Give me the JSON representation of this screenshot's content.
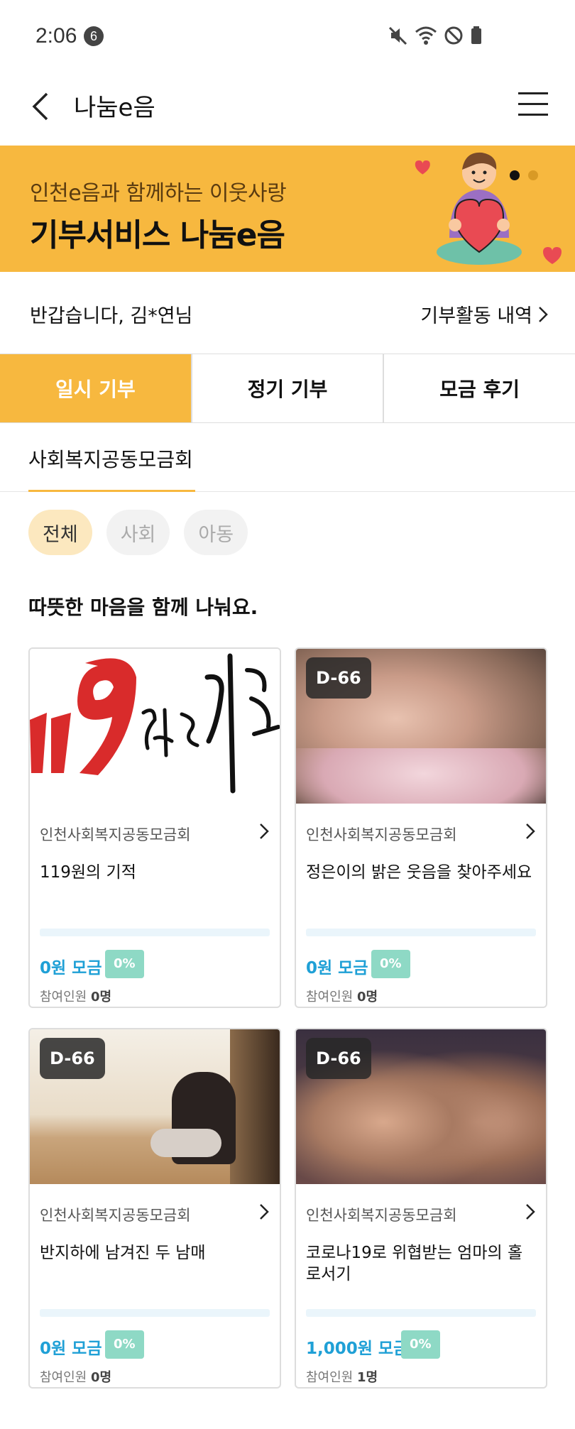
{
  "status_bar": {
    "time": "2:06",
    "notification_count": "6"
  },
  "header": {
    "title": "나눔e음"
  },
  "banner": {
    "subtitle": "인천e음과 함께하는 이웃사랑",
    "title": "기부서비스 나눔e음",
    "page_index": 1,
    "page_count": 2
  },
  "greeting": {
    "text": "반갑습니다, 김*연님",
    "history_link": "기부활동 내역"
  },
  "tabs": [
    {
      "label": "일시 기부",
      "active": true
    },
    {
      "label": "정기 기부",
      "active": false
    },
    {
      "label": "모금 후기",
      "active": false
    }
  ],
  "org_tab": {
    "label": "사회복지공동모금회"
  },
  "chips": [
    {
      "label": "전체",
      "active": true
    },
    {
      "label": "사회",
      "active": false
    },
    {
      "label": "아동",
      "active": false
    }
  ],
  "section_title": "따뜻한 마음을 함께 나눠요.",
  "cards": [
    {
      "dday": "",
      "org": "인천사회복지공동모금회",
      "name": "119원의 기적",
      "amount": "0원 모금",
      "percent": "0%",
      "progress": 0,
      "people_label": "참여인원",
      "people_value": "0명",
      "image": "119-miracle-calligraphy"
    },
    {
      "dday": "D-66",
      "org": "인천사회복지공동모금회",
      "name": "정은이의 밝은 웃음을 찾아주세요",
      "amount": "0원 모금",
      "percent": "0%",
      "progress": 0,
      "people_label": "참여인원",
      "people_value": "0명",
      "image": "blurred-baby-photo"
    },
    {
      "dday": "D-66",
      "org": "인천사회복지공동모금회",
      "name": "반지하에 남겨진 두 남매",
      "amount": "0원 모금",
      "percent": "0%",
      "progress": 0,
      "people_label": "참여인원",
      "people_value": "0명",
      "image": "child-sitting-on-floor"
    },
    {
      "dday": "D-66",
      "org": "인천사회복지공동모금회",
      "name": "코로나19로 위협받는 엄마의 홀로서기",
      "amount": "1,000원 모금",
      "percent": "0%",
      "progress": 0,
      "people_label": "참여인원",
      "people_value": "1명",
      "image": "blurred-children-photo"
    }
  ],
  "colors": {
    "brand": "#F7B83F",
    "accent_blue": "#1FA0D6",
    "percent_badge": "#8ED9C5"
  }
}
